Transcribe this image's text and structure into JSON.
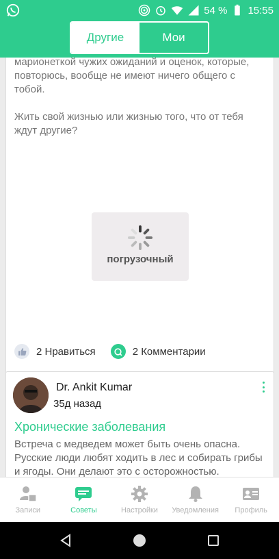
{
  "status_bar": {
    "battery_percent": "54 %",
    "time": "15:55"
  },
  "header": {
    "tabs": [
      {
        "label": "Другие",
        "active": true
      },
      {
        "label": "Мои",
        "active": false
      }
    ]
  },
  "post": {
    "text_lines": [
      "марионеткой чужих ожиданий и оценок, которые, повторюсь, вообще не имеют ничего общего с тобой.",
      "Жить свой жизнью или жизнью того, что от тебя ждут другие?"
    ],
    "loader_label": "погрузочный",
    "likes_label": "2 Нравиться",
    "comments_label": "2 Комментарии"
  },
  "card": {
    "author": "Dr. Ankit Kumar",
    "time_ago": "35д назад",
    "title": "Хронические заболевания",
    "body": "Встреча с медведем может быть очень опасна. Русские люди любят ходить в лес и собирать грибы и ягоды. Они делают это с осторожностью."
  },
  "bottom_nav": [
    {
      "label": "Записи",
      "icon": "user-calendar-icon",
      "active": false
    },
    {
      "label": "Советы",
      "icon": "chat-icon",
      "active": true
    },
    {
      "label": "Настройки",
      "icon": "gear-icon",
      "active": false
    },
    {
      "label": "Уведомления",
      "icon": "bell-icon",
      "active": false
    },
    {
      "label": "Профиль",
      "icon": "id-card-icon",
      "active": false
    }
  ],
  "colors": {
    "accent": "#2ecc8e",
    "inactive_nav": "#b3b3b3"
  }
}
